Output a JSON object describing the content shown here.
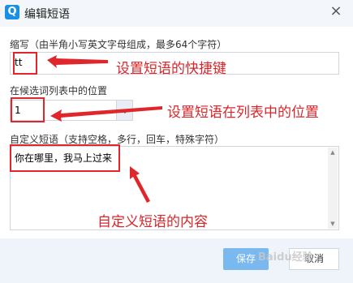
{
  "dialog": {
    "title": "编辑短语",
    "app_icon_letter": "Q",
    "close_symbol": "×"
  },
  "shortcut": {
    "label": "缩写（由半角小写英文字母组成，最多64个字符）",
    "value": "tt"
  },
  "position": {
    "label": "在候选词列表中的位置",
    "value": "1"
  },
  "phrase": {
    "label": "自定义短语（支持空格，多行，回车，特殊字符）",
    "value": "你在哪里，我马上过来"
  },
  "annotations": {
    "shortcut_note": "设置短语的快捷键",
    "position_note": "设置短语在列表中的位置",
    "content_note": "自定义短语的内容",
    "color": "#d8262b"
  },
  "footer": {
    "save_label": "保存",
    "cancel_label": "取消"
  },
  "watermark": "Baidu经验"
}
